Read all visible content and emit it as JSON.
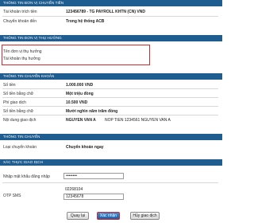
{
  "source_section": {
    "header": "THÔNG TIN ĐƠN VỊ CHUYỂN TIỀN",
    "rows": [
      {
        "label": "Tài khoản trích tiền",
        "value": "123456789 - TG PAYROLL KHTN (CN) VND"
      },
      {
        "label": "Chuyển khoản đến",
        "value": "Trong hệ thống ACB"
      }
    ]
  },
  "beneficiary_section": {
    "header": "THÔNG TIN ĐƠN VỊ THỤ HƯỞNG",
    "rows": [
      {
        "label": "Tên đơn vị thụ hưởng"
      },
      {
        "label": "Tài khoản thụ hưởng"
      }
    ]
  },
  "transfer_section": {
    "header": "THÔNG TIN CHUYỂN KHOẢN",
    "rows": [
      {
        "label": "Số tiền",
        "value": "1.000.000 VND"
      },
      {
        "label": "Số tiền bằng chữ",
        "value": "Một triệu đồng"
      },
      {
        "label": "Phí giao dịch",
        "value": "10.500 VND"
      },
      {
        "label": "Số tiền bằng chữ",
        "value": "Mười nghìn năm trăm đồng"
      },
      {
        "label": "Nội dung giao dịch",
        "value": "NGUYEN VAN A",
        "value_extra": "NOP TIEN 1234561 NGUYEN VAN A"
      }
    ]
  },
  "method_section": {
    "header": "THÔNG TIN CHUYỂN",
    "rows": [
      {
        "label": "Loại chuyển khoản",
        "value": "Chuyển khoản ngay"
      }
    ]
  },
  "auth_section": {
    "header": "XÁC THỰC GIAO DỊCH",
    "password_label": "Nhập mật khẩu đăng nhập",
    "password_value": "••••••••",
    "otp_label": "OTP SMS",
    "otp_code": "02268104",
    "otp_value": "12345678"
  },
  "buttons": {
    "back": "Quay lại",
    "confirm": "Xác nhận",
    "cancel": "Hủy giao dịch"
  }
}
